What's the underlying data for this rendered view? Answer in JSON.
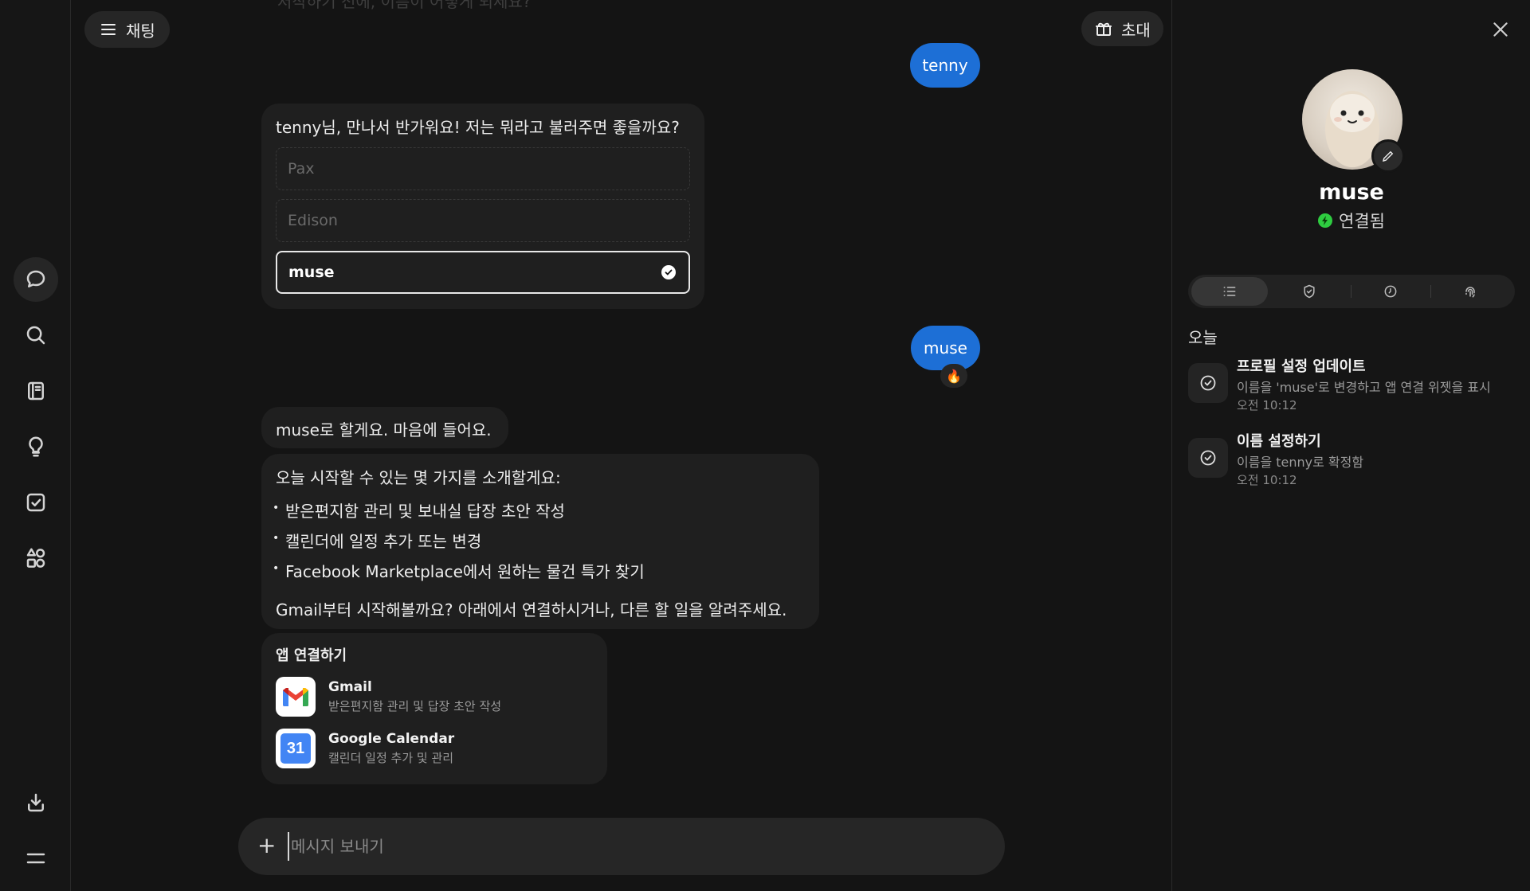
{
  "header": {
    "menu_label": "채팅",
    "invite_label": "초대",
    "faded_previous_text": "저작하기 전에, 이름이 어떻게 되세요?"
  },
  "messages": {
    "user_1": "tenny",
    "ai_name_prompt": "tenny님, 만나서 반가워요! 저는 뭐라고 불러주면 좋을까요?",
    "name_options": [
      "Pax",
      "Edison",
      "muse"
    ],
    "selected_option": "muse",
    "user_2": "muse",
    "user_2_reaction": "🔥",
    "ai_confirm": "muse로 할게요. 마음에 들어요.",
    "ai_intro": "오늘 시작할 수 있는 몇 가지를 소개할게요:",
    "ai_bullets": [
      "받은편지함 관리 및 보내실 답장 초안 작성",
      "캘린더에 일정 추가 또는 변경",
      "Facebook Marketplace에서 원하는 물건 특가 찾기"
    ],
    "ai_followup": "Gmail부터 시작해볼까요? 아래에서 연결하시거나, 다른 할 일을 알려주세요."
  },
  "connect_apps": {
    "title": "앱 연결하기",
    "apps": [
      {
        "name": "Gmail",
        "description": "받은편지함 관리 및 답장 초안 작성",
        "icon": "gmail-icon"
      },
      {
        "name": "Google Calendar",
        "description": "캘린더 일정 추가 및 관리",
        "icon": "google-calendar-icon",
        "badge": "31"
      }
    ]
  },
  "composer": {
    "placeholder": "메시지 보내기"
  },
  "agent": {
    "name": "muse",
    "status": "연결됨",
    "status_color": "#2ecc40"
  },
  "activity": {
    "section_title": "오늘",
    "items": [
      {
        "title": "프로필 설정 업데이트",
        "description": "이름을 'muse'로 변경하고 앱 연결 위젯을 표시",
        "time": "오전 10:12"
      },
      {
        "title": "이름 설정하기",
        "description": "이름을 tenny로 확정함",
        "time": "오전 10:12"
      }
    ]
  },
  "colors": {
    "accent": "#1d6fd6",
    "background": "#141414",
    "bubble": "#1f1f1f"
  }
}
